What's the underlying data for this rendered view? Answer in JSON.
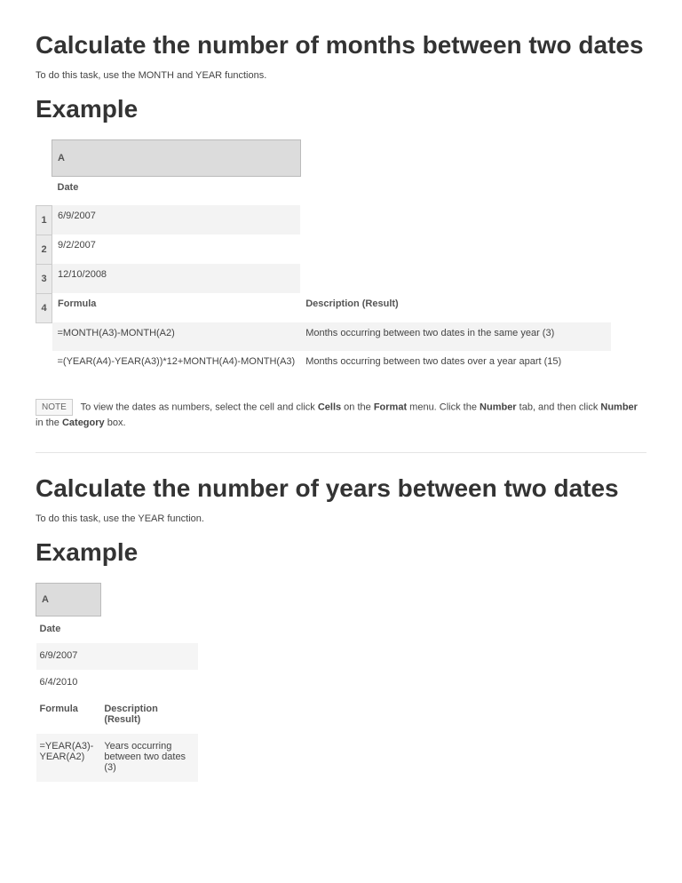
{
  "section1": {
    "heading": "Calculate the number of months between two dates",
    "intro": "To do this task, use the MONTH and YEAR functions.",
    "example_label": "Example",
    "col_header_A": "A",
    "date_label": "Date",
    "rows": {
      "r1_num": "1",
      "r1_val": "6/9/2007",
      "r2_num": "2",
      "r2_val": "9/2/2007",
      "r3_num": "3",
      "r3_val": "12/10/2008",
      "r4_num": "4"
    },
    "formula_label": "Formula",
    "desc_label": "Description (Result)",
    "f1_formula": "=MONTH(A3)-MONTH(A2)",
    "f1_desc": "Months occurring between two dates in the same year (3)",
    "f2_formula": "=(YEAR(A4)-YEAR(A3))*12+MONTH(A4)-MONTH(A3)",
    "f2_desc": "Months occurring between two dates over a year apart (15)"
  },
  "note": {
    "badge": "NOTE",
    "pre": "To view the dates as numbers, select the cell and click ",
    "b1": "Cells",
    "mid1": " on the ",
    "b2": "Format",
    "mid2": " menu. Click the ",
    "b3": "Number",
    "mid3": " tab, and then click ",
    "b4": "Number",
    "mid4": " in the ",
    "b5": "Category",
    "post": " box."
  },
  "section2": {
    "heading": "Calculate the number of years between two dates",
    "intro": "To do this task, use the YEAR function.",
    "example_label": "Example",
    "col_header_A": "A",
    "date_label": "Date",
    "r1_val": "6/9/2007",
    "r2_val": "6/4/2010",
    "formula_label": "Formula",
    "desc_label": "Description (Result)",
    "f1_formula": "=YEAR(A3)-YEAR(A2)",
    "f1_desc": "Years occurring between two dates (3)"
  }
}
